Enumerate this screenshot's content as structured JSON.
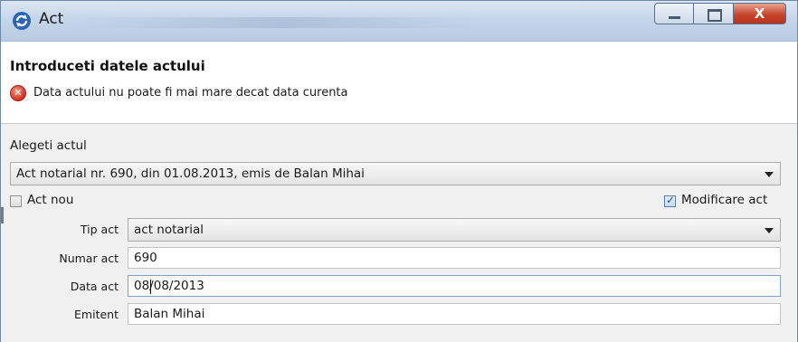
{
  "window": {
    "title": "Act",
    "icon": "blue-circular-arrows-icon",
    "controls": {
      "minimize_icon": "minimize-icon",
      "maximize_icon": "maximize-icon",
      "close_icon": "close-icon",
      "close_glyph": "X"
    },
    "accent_close_color": "#c7452c"
  },
  "header": {
    "title": "Introduceti datele actului",
    "error_icon": "error-icon",
    "error_glyph": "✕",
    "error_message": "Data actului nu poate fi mai mare decat data curenta",
    "error_color": "#d4301f"
  },
  "form": {
    "choose_label": "Alegeti actul",
    "choose_value": "Act notarial nr. 690, din 01.08.2013, emis de Balan Mihai",
    "new_act": {
      "label": "Act nou",
      "checked": false
    },
    "modify_act": {
      "label": "Modificare act",
      "checked": true,
      "tick": "✓"
    },
    "fields": {
      "tip_act": {
        "label": "Tip act",
        "value": "act notarial"
      },
      "numar_act": {
        "label": "Numar act",
        "value": "690"
      },
      "data_act": {
        "label": "Data act",
        "value": "08/08/2013"
      },
      "emitent": {
        "label": "Emitent",
        "value": "Balan Mihai"
      }
    }
  }
}
